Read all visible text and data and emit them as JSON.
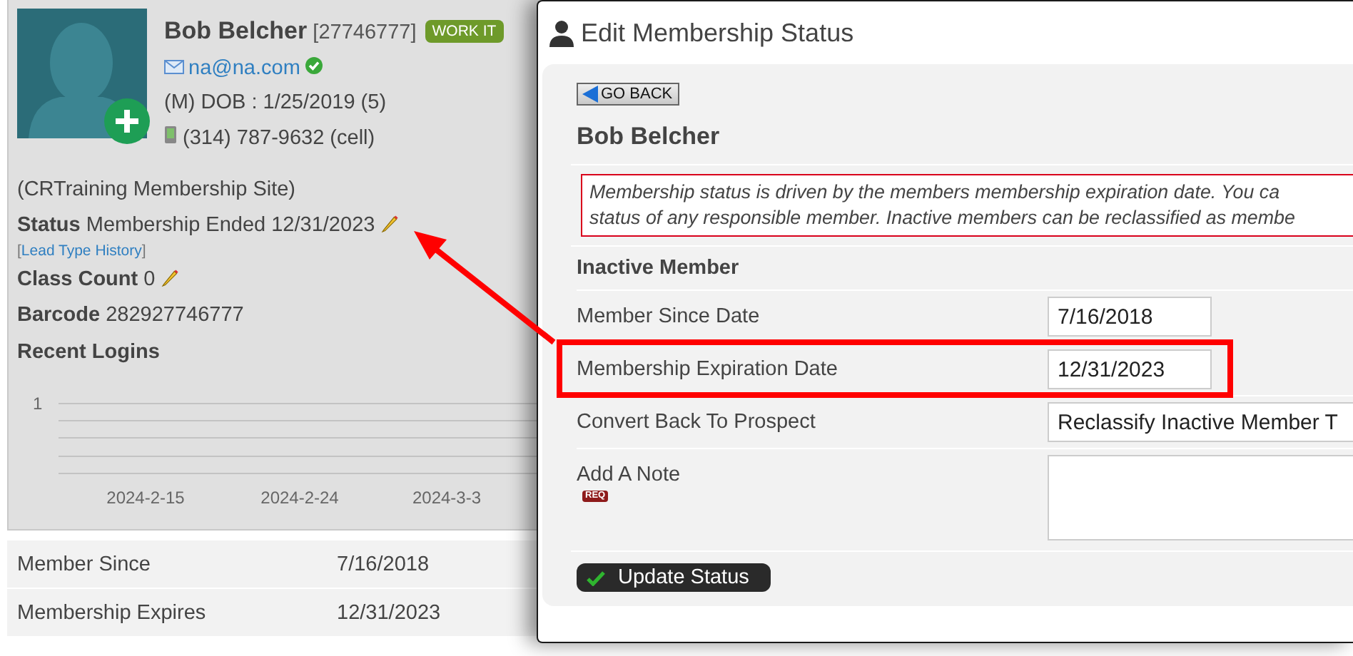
{
  "profile": {
    "name": "Bob Belcher",
    "member_id": "[27746777]",
    "badge": "WORK IT",
    "email": "na@na.com",
    "email_verified": true,
    "dob": "(M) DOB : 1/25/2019 (5)",
    "phone": "(314) 787-9632 (cell)",
    "site": "(CRTraining Membership Site)",
    "status": {
      "label": "Status",
      "value": "Membership Ended 12/31/2023",
      "editable": true
    },
    "history_link": {
      "open": "[",
      "text": "Lead Type History",
      "close": "]"
    },
    "class_count": {
      "label": "Class Count",
      "value": "0",
      "editable": true
    },
    "barcode": {
      "label": "Barcode",
      "value": "282927746777"
    }
  },
  "recent_logins": {
    "title": "Recent Logins",
    "y_tick": "1",
    "x_labels": [
      "2024-2-15",
      "2024-2-24",
      "2024-3-3"
    ]
  },
  "info_rows": [
    {
      "label": "Member Since",
      "value": "7/16/2018"
    },
    {
      "label": "Membership Expires",
      "value": "12/31/2023"
    }
  ],
  "modal": {
    "title": "Edit Membership Status",
    "back_button": "GO BACK",
    "member_name": "Bob Belcher",
    "notice": "Membership status is driven by the members membership expiration date. You ca\nstatus of any responsible member. Inactive members can be reclassified as membe",
    "section": "Inactive Member",
    "fields": [
      {
        "kind": "date",
        "label": "Member Since Date",
        "value": "7/16/2018",
        "highlighted": false
      },
      {
        "kind": "date",
        "label": "Membership Expiration Date",
        "value": "12/31/2023",
        "highlighted": true
      },
      {
        "kind": "select",
        "label": "Convert Back To Prospect",
        "value": "Reclassify Inactive Member T",
        "highlighted": false
      },
      {
        "kind": "textarea",
        "label": "Add A Note",
        "required_badge": "REQ",
        "highlighted": false
      }
    ],
    "submit": "Update Status"
  }
}
